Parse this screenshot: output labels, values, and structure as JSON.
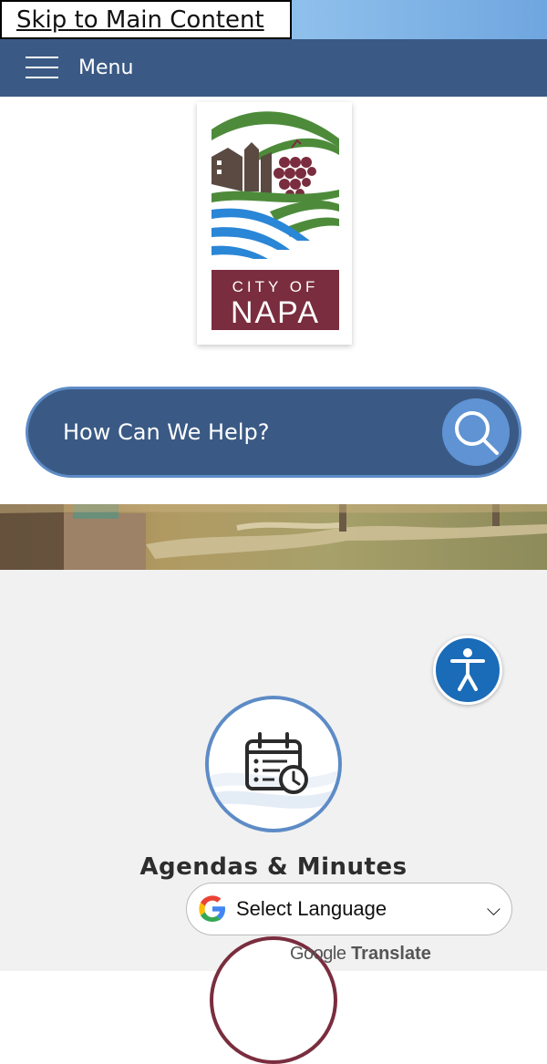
{
  "skip_link": {
    "label": "Skip to Main Content"
  },
  "header": {
    "menu_label": "Menu"
  },
  "logo": {
    "line1": "CITY OF",
    "line2": "NAPA",
    "alt": "City of Napa"
  },
  "search": {
    "placeholder": "How Can We Help?"
  },
  "quick_links": [
    {
      "label": "Agendas & Minutes",
      "icon": "calendar-clock-icon"
    }
  ],
  "translate": {
    "select_label": "Select Language",
    "google_word": "Google",
    "translate_word": "Translate"
  },
  "colors": {
    "nav_blue": "#3a5a85",
    "accent_blue": "#5d8bc6",
    "wine": "#7a2d3e",
    "olive": "#4d8b3a",
    "river_blue": "#2a86d6"
  }
}
